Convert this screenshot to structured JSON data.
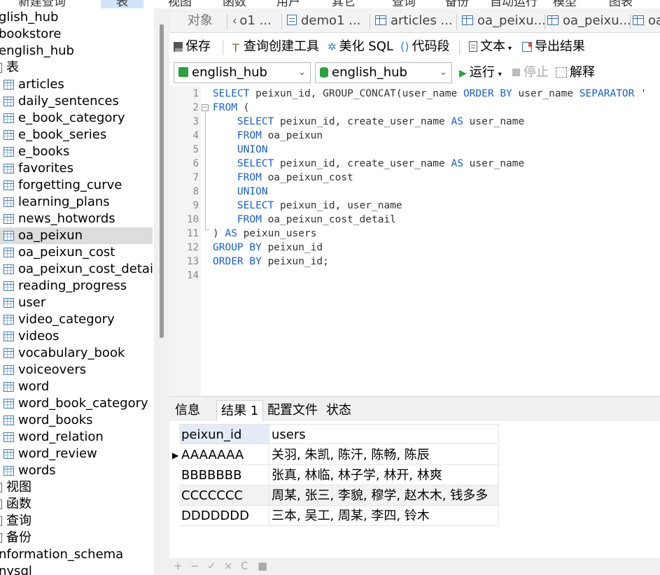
{
  "top_menu": [
    "新建查询",
    "表",
    "视图",
    "函数",
    "用户",
    "其它",
    "查询",
    "备份",
    "自动运行",
    "模型",
    "图表"
  ],
  "sidebar": {
    "items": [
      {
        "label": "glish_hub",
        "type": "db"
      },
      {
        "label": "bookstore",
        "type": "db"
      },
      {
        "label": "english_hub",
        "type": "db"
      },
      {
        "label": "表",
        "type": "folder"
      },
      {
        "label": "articles",
        "type": "table"
      },
      {
        "label": "daily_sentences",
        "type": "table"
      },
      {
        "label": "e_book_category",
        "type": "table"
      },
      {
        "label": "e_book_series",
        "type": "table"
      },
      {
        "label": "e_books",
        "type": "table"
      },
      {
        "label": "favorites",
        "type": "table"
      },
      {
        "label": "forgetting_curve",
        "type": "table"
      },
      {
        "label": "learning_plans",
        "type": "table"
      },
      {
        "label": "news_hotwords",
        "type": "table"
      },
      {
        "label": "oa_peixun",
        "type": "table",
        "selected": true
      },
      {
        "label": "oa_peixun_cost",
        "type": "table"
      },
      {
        "label": "oa_peixun_cost_detail",
        "type": "table"
      },
      {
        "label": "reading_progress",
        "type": "table"
      },
      {
        "label": "user",
        "type": "table"
      },
      {
        "label": "video_category",
        "type": "table"
      },
      {
        "label": "videos",
        "type": "table"
      },
      {
        "label": "vocabulary_book",
        "type": "table"
      },
      {
        "label": "voiceovers",
        "type": "table"
      },
      {
        "label": "word",
        "type": "table"
      },
      {
        "label": "word_book_category",
        "type": "table"
      },
      {
        "label": "word_books",
        "type": "table"
      },
      {
        "label": "word_relation",
        "type": "table"
      },
      {
        "label": "word_review",
        "type": "table"
      },
      {
        "label": "words",
        "type": "table"
      },
      {
        "label": "视图",
        "type": "folder"
      },
      {
        "label": "函数",
        "type": "folder"
      },
      {
        "label": "查询",
        "type": "folder"
      },
      {
        "label": "备份",
        "type": "folder"
      },
      {
        "label": "nformation_schema",
        "type": "db"
      },
      {
        "label": "nysql",
        "type": "db"
      }
    ]
  },
  "tabs": {
    "object": "对象",
    "items": [
      "o1 ...",
      "demo1 ...",
      "articles ...",
      "oa_peixu...",
      "oa_peixu...",
      "oa"
    ]
  },
  "toolbar": {
    "save": "保存",
    "query_builder": "查询创建工具",
    "beautify": "美化 SQL",
    "snippet": "代码段",
    "text": "文本",
    "export": "导出结果"
  },
  "toolbar2": {
    "connection": "english_hub",
    "database": "english_hub",
    "run": "运行",
    "stop": "停止",
    "explain": "解释"
  },
  "editor": {
    "lines": [
      [
        [
          "kw",
          "SELECT"
        ],
        [
          "t",
          " peixun_id, GROUP_CONCAT(user_name "
        ],
        [
          "kw",
          "ORDER BY"
        ],
        [
          "t",
          " user_name "
        ],
        [
          "kw",
          "SEPARATOR"
        ],
        [
          "t",
          " '"
        ]
      ],
      [
        [
          "kw",
          "FROM"
        ],
        [
          "t",
          " ("
        ]
      ],
      [
        [
          "t",
          "    "
        ],
        [
          "kw",
          "SELECT"
        ],
        [
          "t",
          " peixun_id, create_user_name "
        ],
        [
          "kw",
          "AS"
        ],
        [
          "t",
          " user_name"
        ]
      ],
      [
        [
          "t",
          "    "
        ],
        [
          "kw",
          "FROM"
        ],
        [
          "t",
          " oa_peixun"
        ]
      ],
      [
        [
          "t",
          "    "
        ],
        [
          "kw",
          "UNION"
        ]
      ],
      [
        [
          "t",
          "    "
        ],
        [
          "kw",
          "SELECT"
        ],
        [
          "t",
          " peixun_id, create_user_name "
        ],
        [
          "kw",
          "AS"
        ],
        [
          "t",
          " user_name"
        ]
      ],
      [
        [
          "t",
          "    "
        ],
        [
          "kw",
          "FROM"
        ],
        [
          "t",
          " oa_peixun_cost"
        ]
      ],
      [
        [
          "t",
          "    "
        ],
        [
          "kw",
          "UNION"
        ]
      ],
      [
        [
          "t",
          "    "
        ],
        [
          "kw",
          "SELECT"
        ],
        [
          "t",
          " peixun_id, user_name"
        ]
      ],
      [
        [
          "t",
          "    "
        ],
        [
          "kw",
          "FROM"
        ],
        [
          "t",
          " oa_peixun_cost_detail"
        ]
      ],
      [
        [
          "t",
          ") "
        ],
        [
          "kw",
          "AS"
        ],
        [
          "t",
          " peixun_users"
        ]
      ],
      [
        [
          "kw",
          "GROUP BY"
        ],
        [
          "t",
          " peixun_id"
        ]
      ],
      [
        [
          "kw",
          "ORDER BY"
        ],
        [
          "t",
          " peixun_id;"
        ]
      ],
      [
        [
          "t",
          ""
        ]
      ]
    ]
  },
  "result_tabs": [
    "信息",
    "结果 1",
    "配置文件",
    "状态"
  ],
  "result": {
    "columns": [
      "peixun_id",
      "users"
    ],
    "rows": [
      [
        "AAAAAAA",
        "关羽, 朱凯, 陈汗, 陈畅, 陈辰"
      ],
      [
        "BBBBBBB",
        "张真, 林临, 林子学, 林开, 林爽"
      ],
      [
        "CCCCCCC",
        "周某, 张三, 李貌, 穆学, 赵木木, 钱多多"
      ],
      [
        "DDDDDDD",
        "三本, 吴工, 周某, 李四, 铃木"
      ]
    ]
  },
  "status_icons": [
    "+",
    "−",
    "✓",
    "×",
    "C",
    "■"
  ],
  "colors": {
    "keyword": "#1a5fc4",
    "selected_row": "#dddddd",
    "header_selected": "#e3ecf6",
    "run_green": "#2ea043"
  }
}
